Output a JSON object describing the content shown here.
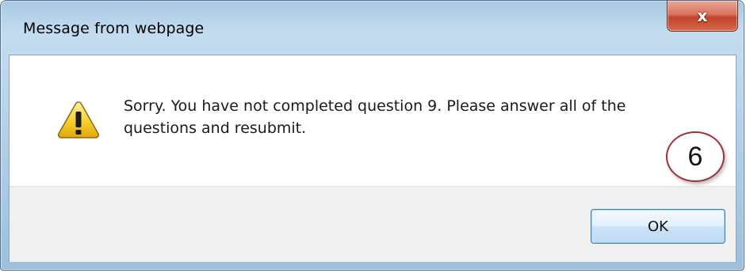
{
  "window": {
    "title": "Message from webpage",
    "close_glyph": "x"
  },
  "dialog": {
    "icon": "warning-icon",
    "message": "Sorry. You have not completed question 9. Please answer all of the questions and resubmit.",
    "ok_label": "OK"
  },
  "annotation": {
    "step_number": "6"
  },
  "colors": {
    "titlebar": "#b8d3ea",
    "close_button": "#c0442a",
    "button_area": "#f0f0f0",
    "ok_border": "#3c7fb1",
    "marker_ring": "#a0303a"
  }
}
